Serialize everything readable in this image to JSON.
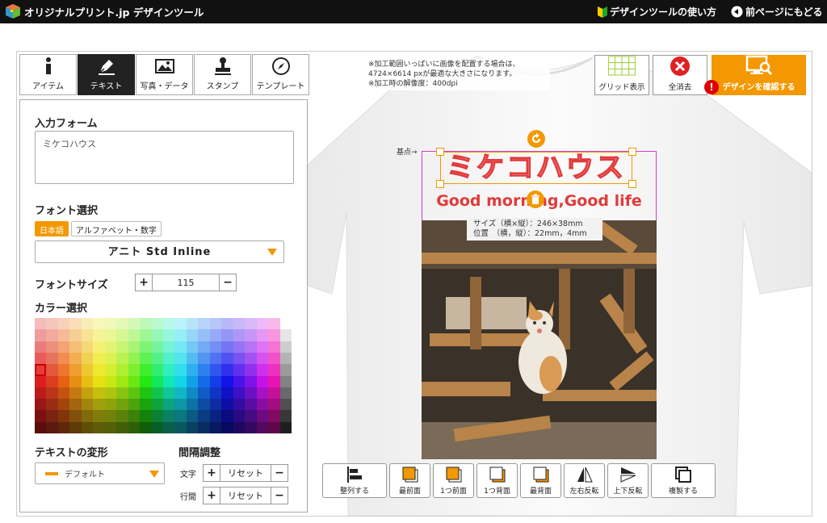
{
  "header": {
    "logo_text": "オリジナルプリント.jp デザインツール",
    "how_to": "デザインツールの使い方",
    "back": "前ページにもどる"
  },
  "tabs": [
    {
      "label": "アイテム",
      "icon": "info-icon",
      "active": false
    },
    {
      "label": "テキスト",
      "icon": "pen-icon",
      "active": true
    },
    {
      "label": "写真・データ",
      "icon": "image-icon",
      "active": false
    },
    {
      "label": "スタンプ",
      "icon": "stamp-icon",
      "active": false
    },
    {
      "label": "テンプレート",
      "icon": "compass-icon",
      "active": false
    }
  ],
  "text_panel": {
    "input_heading": "入力フォーム",
    "input_value": "ミケコハウス",
    "font_heading": "フォント選択",
    "font_tabs": [
      "日本語",
      "アルファベット・数字"
    ],
    "font_selected": "アニト Std Inline",
    "size_heading": "フォントサイズ",
    "size_value": "115",
    "color_heading": "カラー選択",
    "transform_heading": "テキストの変形",
    "transform_value": "デフォルト",
    "spacing_heading": "間隔調整",
    "spacing_char_label": "文字",
    "spacing_line_label": "行間",
    "reset_label": "リセット",
    "plus": "+",
    "minus": "−"
  },
  "canvas": {
    "notice": "※加工範囲いっぱいに画像を配置する場合は、4724×6614 pxが最適な大きさになります。※加工時の解像度：400dpi",
    "notice_lines": [
      "※加工範囲いっぱいに画像を配置する場合は、",
      "4724×6614 pxが最適な大きさになります。",
      "※加工時の解像度：400dpi"
    ],
    "main_text": "ミケコハウス",
    "sub_text": "Good morning,Good life",
    "size_info": "サイズ（横×縦）：246×38mm",
    "pos_info": "位置　（横，縦）：22mm，4mm",
    "base_point": "基点→"
  },
  "actions": {
    "grid": "グリッド表示",
    "clear": "全消去",
    "confirm": "デザインを確認する"
  },
  "toolbar": [
    {
      "label": "整列する",
      "icon": "align-icon"
    },
    {
      "label": "最前面",
      "icon": "bring-front-icon"
    },
    {
      "label": "1つ前面",
      "icon": "bring-forward-icon"
    },
    {
      "label": "1つ背面",
      "icon": "send-backward-icon"
    },
    {
      "label": "最背面",
      "icon": "send-back-icon"
    },
    {
      "label": "左右反転",
      "icon": "flip-horizontal-icon"
    },
    {
      "label": "上下反転",
      "icon": "flip-vertical-icon"
    },
    {
      "label": "複製する",
      "icon": "duplicate-icon"
    }
  ],
  "colors": {
    "accent": "#f39800",
    "text_red": "#e23a3a",
    "guide": "#d03fd0"
  }
}
